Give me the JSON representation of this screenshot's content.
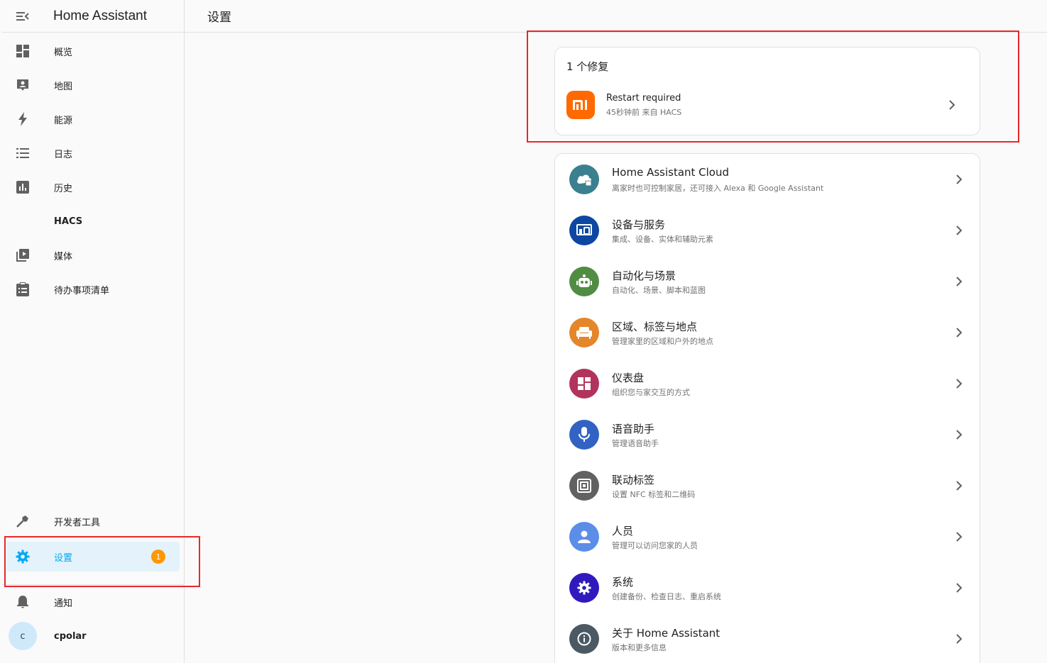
{
  "app_title": "Home Assistant",
  "page_title": "设置",
  "sidebar": {
    "items": [
      {
        "label": "概览",
        "icon": "dashboard-icon"
      },
      {
        "label": "地图",
        "icon": "map-account-icon"
      },
      {
        "label": "能源",
        "icon": "lightning-bolt-icon"
      },
      {
        "label": "日志",
        "icon": "format-list-icon"
      },
      {
        "label": "历史",
        "icon": "chart-box-icon"
      },
      {
        "label": "HACS",
        "icon": "hacs-icon"
      },
      {
        "label": "媒体",
        "icon": "play-box-multiple-icon"
      },
      {
        "label": "待办事项清单",
        "icon": "clipboard-list-icon"
      }
    ],
    "bottom": {
      "dev_tools": "开发者工具",
      "settings": "设置",
      "settings_badge": "1",
      "notifications": "通知",
      "user_name": "cpolar",
      "user_initial": "c"
    }
  },
  "repairs": {
    "title": "1 个修复",
    "item": {
      "title": "Restart required",
      "subtitle": "45秒钟前 来自 HACS"
    }
  },
  "settings_menu": [
    {
      "title": "Home Assistant Cloud",
      "subtitle": "离家时也可控制家居，还可接入 Alexa 和 Google Assistant",
      "icon": "cloud-lock-icon",
      "color": "#3b808e"
    },
    {
      "title": "设备与服务",
      "subtitle": "集成、设备、实体和辅助元素",
      "icon": "devices-icon",
      "color": "#0d47a1"
    },
    {
      "title": "自动化与场景",
      "subtitle": "自动化、场景、脚本和蓝图",
      "icon": "robot-icon",
      "color": "#518c43"
    },
    {
      "title": "区域、标签与地点",
      "subtitle": "管理家里的区域和户外的地点",
      "icon": "sofa-icon",
      "color": "#e48629"
    },
    {
      "title": "仪表盘",
      "subtitle": "组织您与家交互的方式",
      "icon": "view-dashboard-icon",
      "color": "#b1345c"
    },
    {
      "title": "语音助手",
      "subtitle": "管理语音助手",
      "icon": "microphone-icon",
      "color": "#3263c3"
    },
    {
      "title": "联动标签",
      "subtitle": "设置 NFC 标签和二维码",
      "icon": "nfc-tag-icon",
      "color": "#616161"
    },
    {
      "title": "人员",
      "subtitle": "管理可以访问您家的人员",
      "icon": "account-icon",
      "color": "#5c8ee8"
    },
    {
      "title": "系统",
      "subtitle": "创建备份、检查日志、重启系统",
      "icon": "cog-icon",
      "color": "#301ABE"
    },
    {
      "title": "关于 Home Assistant",
      "subtitle": "版本和更多信息",
      "icon": "information-icon",
      "color": "#4a5963"
    }
  ]
}
